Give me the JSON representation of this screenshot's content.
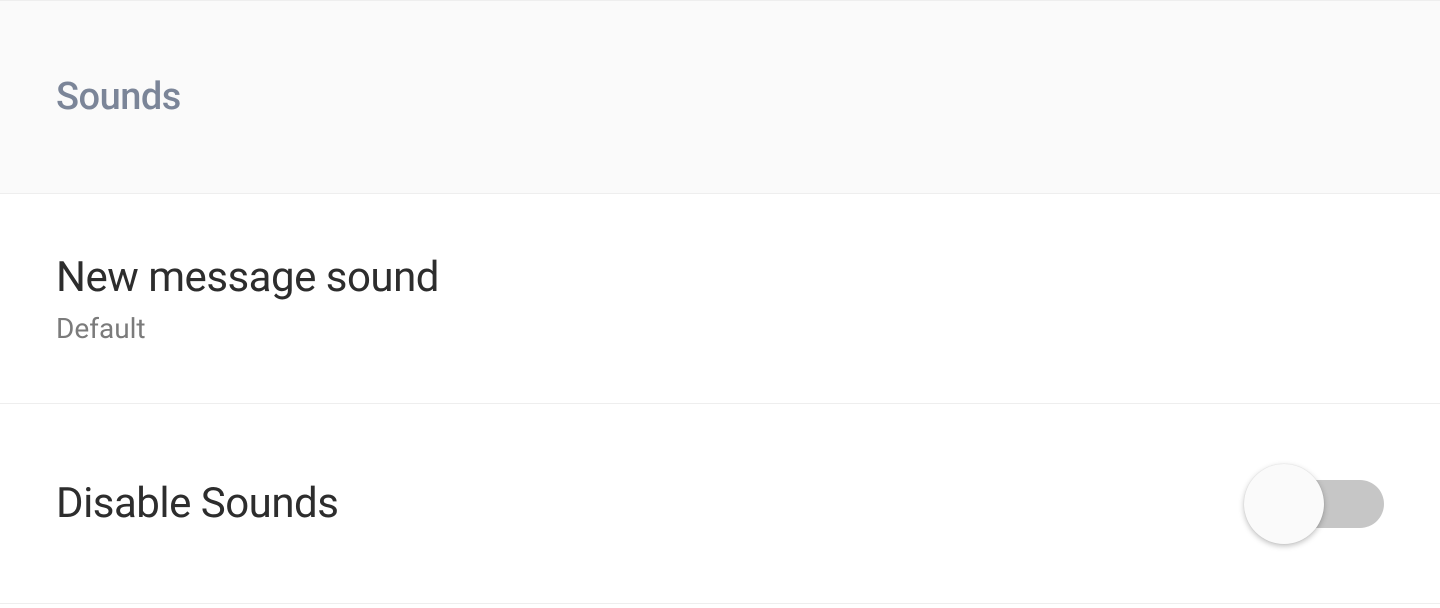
{
  "section": {
    "title": "Sounds"
  },
  "settings": {
    "new_message_sound": {
      "label": "New message sound",
      "value": "Default"
    },
    "disable_sounds": {
      "label": "Disable Sounds",
      "enabled": false
    }
  }
}
